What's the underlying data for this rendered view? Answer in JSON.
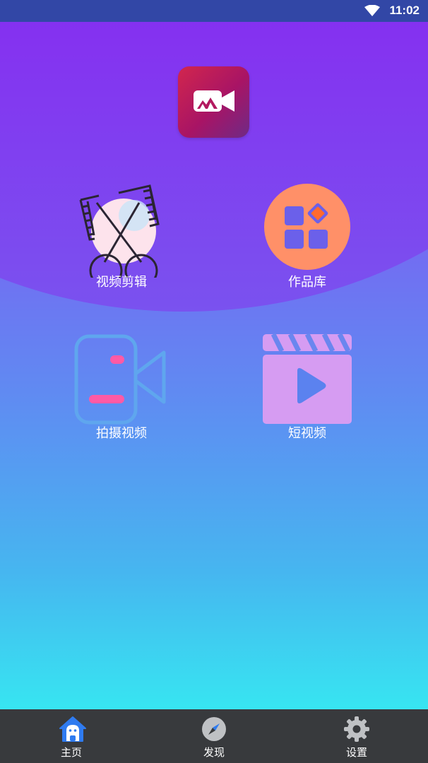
{
  "status_bar": {
    "time": "11:02",
    "wifi_icon": "wifi-icon"
  },
  "app": {
    "logo_icon": "video-camera-mountain-icon",
    "logo_colors": [
      "#d2264d",
      "#6e2a86"
    ]
  },
  "tiles": [
    {
      "label": "视频剪辑",
      "icon": "film-scissors-icon"
    },
    {
      "label": "作品库",
      "icon": "gallery-grid-icon"
    },
    {
      "label": "拍摄视频",
      "icon": "video-camera-icon"
    },
    {
      "label": "短视频",
      "icon": "clapperboard-play-icon"
    }
  ],
  "tabbar": {
    "items": [
      {
        "label": "主页",
        "icon": "home-icon",
        "active": true
      },
      {
        "label": "发现",
        "icon": "compass-icon",
        "active": false
      },
      {
        "label": "设置",
        "icon": "gear-icon",
        "active": false
      }
    ]
  },
  "colors": {
    "status_bar": "#3247a6",
    "gradient_top": "#8a3ff0",
    "gradient_bottom": "#37e5f1",
    "tabbar": "#383a3d",
    "gallery_circle": "#ff9068",
    "clapper": "#d69cf2"
  }
}
